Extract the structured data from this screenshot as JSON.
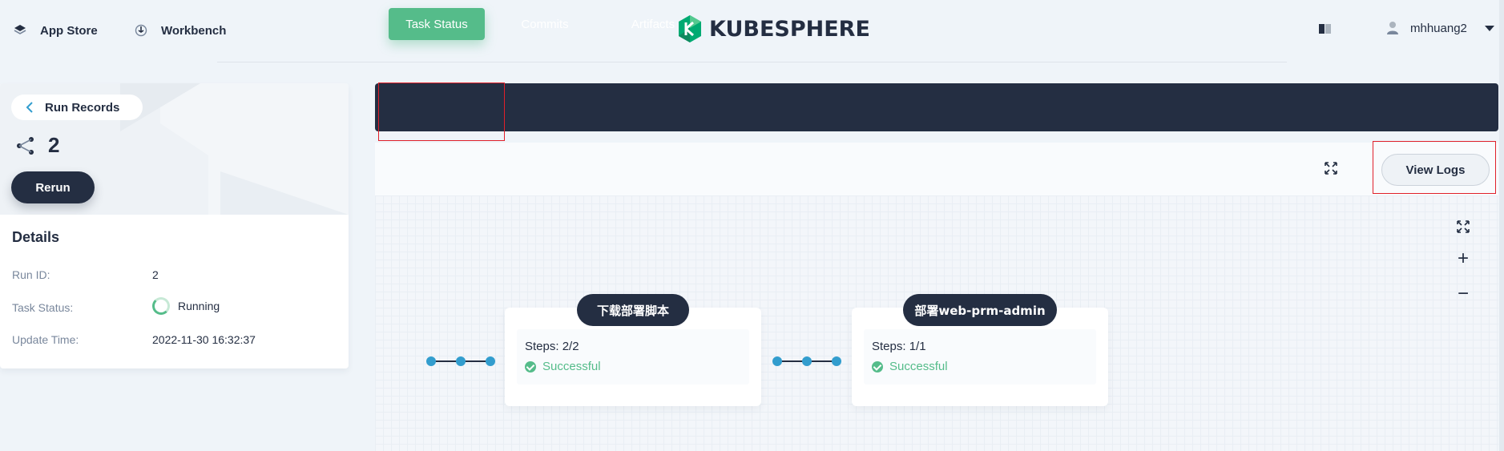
{
  "header": {
    "app_store": "App Store",
    "workbench": "Workbench",
    "logo_text": "KUBESPHERE",
    "username": "mhhuang2"
  },
  "left": {
    "back_label": "Run Records",
    "run_number": "2",
    "rerun_label": "Rerun",
    "details_title": "Details",
    "details": [
      {
        "label": "Run ID:",
        "value": "2"
      },
      {
        "label": "Task Status:",
        "value": "Running"
      },
      {
        "label": "Update Time:",
        "value": "2022-11-30 16:32:37"
      }
    ]
  },
  "tabs": [
    {
      "label": "Task Status",
      "active": true
    },
    {
      "label": "Commits",
      "active": false
    },
    {
      "label": "Artifacts",
      "active": false
    }
  ],
  "toolbar": {
    "view_logs": "View Logs"
  },
  "canvas_tools": {
    "zoom_in": "+",
    "zoom_out": "−"
  },
  "stages": [
    {
      "name": "下载部署脚本",
      "steps": "Steps: 2/2",
      "status": "Successful"
    },
    {
      "name": "部署web-prm-admin",
      "steps": "Steps: 1/1",
      "status": "Successful"
    }
  ],
  "colors": {
    "dark": "#242e42",
    "success": "#55bc8a",
    "link_dot": "#329dce",
    "highlight": "#e0202a"
  }
}
